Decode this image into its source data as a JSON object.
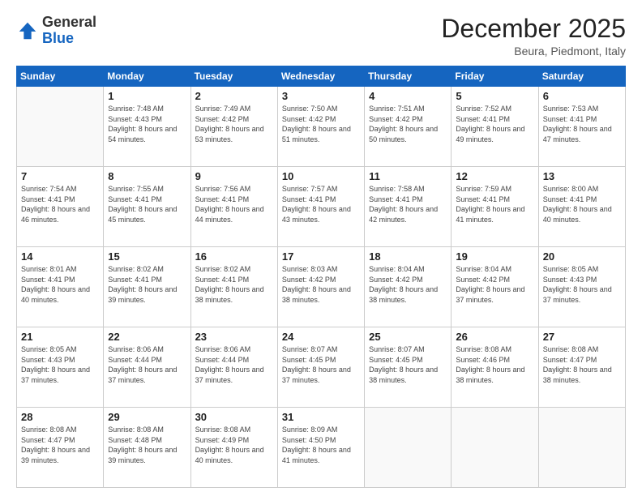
{
  "logo": {
    "general": "General",
    "blue": "Blue"
  },
  "header": {
    "month": "December 2025",
    "location": "Beura, Piedmont, Italy"
  },
  "weekdays": [
    "Sunday",
    "Monday",
    "Tuesday",
    "Wednesday",
    "Thursday",
    "Friday",
    "Saturday"
  ],
  "weeks": [
    [
      {
        "num": "",
        "sunrise": "",
        "sunset": "",
        "daylight": ""
      },
      {
        "num": "1",
        "sunrise": "Sunrise: 7:48 AM",
        "sunset": "Sunset: 4:43 PM",
        "daylight": "Daylight: 8 hours and 54 minutes."
      },
      {
        "num": "2",
        "sunrise": "Sunrise: 7:49 AM",
        "sunset": "Sunset: 4:42 PM",
        "daylight": "Daylight: 8 hours and 53 minutes."
      },
      {
        "num": "3",
        "sunrise": "Sunrise: 7:50 AM",
        "sunset": "Sunset: 4:42 PM",
        "daylight": "Daylight: 8 hours and 51 minutes."
      },
      {
        "num": "4",
        "sunrise": "Sunrise: 7:51 AM",
        "sunset": "Sunset: 4:42 PM",
        "daylight": "Daylight: 8 hours and 50 minutes."
      },
      {
        "num": "5",
        "sunrise": "Sunrise: 7:52 AM",
        "sunset": "Sunset: 4:41 PM",
        "daylight": "Daylight: 8 hours and 49 minutes."
      },
      {
        "num": "6",
        "sunrise": "Sunrise: 7:53 AM",
        "sunset": "Sunset: 4:41 PM",
        "daylight": "Daylight: 8 hours and 47 minutes."
      }
    ],
    [
      {
        "num": "7",
        "sunrise": "Sunrise: 7:54 AM",
        "sunset": "Sunset: 4:41 PM",
        "daylight": "Daylight: 8 hours and 46 minutes."
      },
      {
        "num": "8",
        "sunrise": "Sunrise: 7:55 AM",
        "sunset": "Sunset: 4:41 PM",
        "daylight": "Daylight: 8 hours and 45 minutes."
      },
      {
        "num": "9",
        "sunrise": "Sunrise: 7:56 AM",
        "sunset": "Sunset: 4:41 PM",
        "daylight": "Daylight: 8 hours and 44 minutes."
      },
      {
        "num": "10",
        "sunrise": "Sunrise: 7:57 AM",
        "sunset": "Sunset: 4:41 PM",
        "daylight": "Daylight: 8 hours and 43 minutes."
      },
      {
        "num": "11",
        "sunrise": "Sunrise: 7:58 AM",
        "sunset": "Sunset: 4:41 PM",
        "daylight": "Daylight: 8 hours and 42 minutes."
      },
      {
        "num": "12",
        "sunrise": "Sunrise: 7:59 AM",
        "sunset": "Sunset: 4:41 PM",
        "daylight": "Daylight: 8 hours and 41 minutes."
      },
      {
        "num": "13",
        "sunrise": "Sunrise: 8:00 AM",
        "sunset": "Sunset: 4:41 PM",
        "daylight": "Daylight: 8 hours and 40 minutes."
      }
    ],
    [
      {
        "num": "14",
        "sunrise": "Sunrise: 8:01 AM",
        "sunset": "Sunset: 4:41 PM",
        "daylight": "Daylight: 8 hours and 40 minutes."
      },
      {
        "num": "15",
        "sunrise": "Sunrise: 8:02 AM",
        "sunset": "Sunset: 4:41 PM",
        "daylight": "Daylight: 8 hours and 39 minutes."
      },
      {
        "num": "16",
        "sunrise": "Sunrise: 8:02 AM",
        "sunset": "Sunset: 4:41 PM",
        "daylight": "Daylight: 8 hours and 38 minutes."
      },
      {
        "num": "17",
        "sunrise": "Sunrise: 8:03 AM",
        "sunset": "Sunset: 4:42 PM",
        "daylight": "Daylight: 8 hours and 38 minutes."
      },
      {
        "num": "18",
        "sunrise": "Sunrise: 8:04 AM",
        "sunset": "Sunset: 4:42 PM",
        "daylight": "Daylight: 8 hours and 38 minutes."
      },
      {
        "num": "19",
        "sunrise": "Sunrise: 8:04 AM",
        "sunset": "Sunset: 4:42 PM",
        "daylight": "Daylight: 8 hours and 37 minutes."
      },
      {
        "num": "20",
        "sunrise": "Sunrise: 8:05 AM",
        "sunset": "Sunset: 4:43 PM",
        "daylight": "Daylight: 8 hours and 37 minutes."
      }
    ],
    [
      {
        "num": "21",
        "sunrise": "Sunrise: 8:05 AM",
        "sunset": "Sunset: 4:43 PM",
        "daylight": "Daylight: 8 hours and 37 minutes."
      },
      {
        "num": "22",
        "sunrise": "Sunrise: 8:06 AM",
        "sunset": "Sunset: 4:44 PM",
        "daylight": "Daylight: 8 hours and 37 minutes."
      },
      {
        "num": "23",
        "sunrise": "Sunrise: 8:06 AM",
        "sunset": "Sunset: 4:44 PM",
        "daylight": "Daylight: 8 hours and 37 minutes."
      },
      {
        "num": "24",
        "sunrise": "Sunrise: 8:07 AM",
        "sunset": "Sunset: 4:45 PM",
        "daylight": "Daylight: 8 hours and 37 minutes."
      },
      {
        "num": "25",
        "sunrise": "Sunrise: 8:07 AM",
        "sunset": "Sunset: 4:45 PM",
        "daylight": "Daylight: 8 hours and 38 minutes."
      },
      {
        "num": "26",
        "sunrise": "Sunrise: 8:08 AM",
        "sunset": "Sunset: 4:46 PM",
        "daylight": "Daylight: 8 hours and 38 minutes."
      },
      {
        "num": "27",
        "sunrise": "Sunrise: 8:08 AM",
        "sunset": "Sunset: 4:47 PM",
        "daylight": "Daylight: 8 hours and 38 minutes."
      }
    ],
    [
      {
        "num": "28",
        "sunrise": "Sunrise: 8:08 AM",
        "sunset": "Sunset: 4:47 PM",
        "daylight": "Daylight: 8 hours and 39 minutes."
      },
      {
        "num": "29",
        "sunrise": "Sunrise: 8:08 AM",
        "sunset": "Sunset: 4:48 PM",
        "daylight": "Daylight: 8 hours and 39 minutes."
      },
      {
        "num": "30",
        "sunrise": "Sunrise: 8:08 AM",
        "sunset": "Sunset: 4:49 PM",
        "daylight": "Daylight: 8 hours and 40 minutes."
      },
      {
        "num": "31",
        "sunrise": "Sunrise: 8:09 AM",
        "sunset": "Sunset: 4:50 PM",
        "daylight": "Daylight: 8 hours and 41 minutes."
      },
      {
        "num": "",
        "sunrise": "",
        "sunset": "",
        "daylight": ""
      },
      {
        "num": "",
        "sunrise": "",
        "sunset": "",
        "daylight": ""
      },
      {
        "num": "",
        "sunrise": "",
        "sunset": "",
        "daylight": ""
      }
    ]
  ]
}
